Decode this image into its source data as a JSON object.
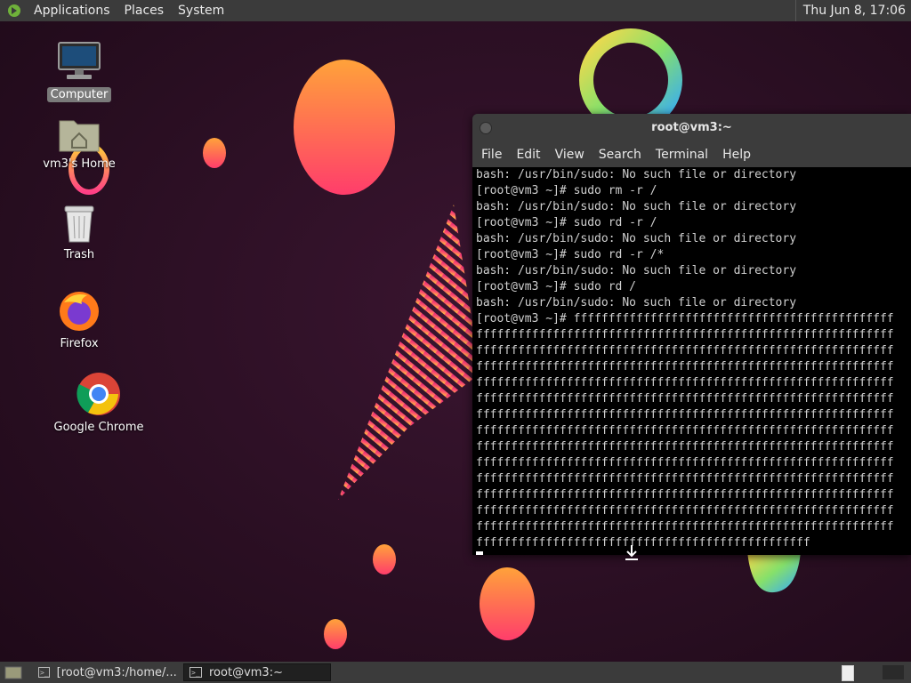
{
  "top_panel": {
    "menus": [
      "Applications",
      "Places",
      "System"
    ],
    "clock": "Thu Jun  8, 17:06"
  },
  "desktop": {
    "icons": [
      {
        "label": "Computer",
        "icon": "computer-icon"
      },
      {
        "label": "vm3's Home",
        "icon": "home-folder-icon"
      },
      {
        "label": "Trash",
        "icon": "trash-icon"
      },
      {
        "label": "Firefox",
        "icon": "firefox-icon"
      },
      {
        "label": "Google Chrome",
        "icon": "chrome-icon"
      }
    ]
  },
  "terminal": {
    "title": "root@vm3:~",
    "menu": [
      "File",
      "Edit",
      "View",
      "Search",
      "Terminal",
      "Help"
    ],
    "lines": [
      "bash: /usr/bin/sudo: No such file or directory",
      "[root@vm3 ~]# sudo rm -r /",
      "bash: /usr/bin/sudo: No such file or directory",
      "[root@vm3 ~]# sudo rd -r /",
      "bash: /usr/bin/sudo: No such file or directory",
      "[root@vm3 ~]# sudo rd -r /*",
      "bash: /usr/bin/sudo: No such file or directory",
      "[root@vm3 ~]# sudo rd /",
      "bash: /usr/bin/sudo: No such file or directory",
      "[root@vm3 ~]# ffffffffffffffffffffffffffffffffffffffffffffff",
      "ffffffffffffffffffffffffffffffffffffffffffffffffffffffffffff",
      "ffffffffffffffffffffffffffffffffffffffffffffffffffffffffffff",
      "ffffffffffffffffffffffffffffffffffffffffffffffffffffffffffff",
      "ffffffffffffffffffffffffffffffffffffffffffffffffffffffffffff",
      "ffffffffffffffffffffffffffffffffffffffffffffffffffffffffffff",
      "ffffffffffffffffffffffffffffffffffffffffffffffffffffffffffff",
      "ffffffffffffffffffffffffffffffffffffffffffffffffffffffffffff",
      "ffffffffffffffffffffffffffffffffffffffffffffffffffffffffffff",
      "ffffffffffffffffffffffffffffffffffffffffffffffffffffffffffff",
      "ffffffffffffffffffffffffffffffffffffffffffffffffffffffffffff",
      "ffffffffffffffffffffffffffffffffffffffffffffffffffffffffffff",
      "ffffffffffffffffffffffffffffffffffffffffffffffffffffffffffff",
      "ffffffffffffffffffffffffffffffffffffffffffffffffffffffffffff",
      "ffffffffffffffffffffffffffffffffffffffffffffffff"
    ]
  },
  "bottom_panel": {
    "tasks": [
      {
        "label": "[root@vm3:/home/...",
        "active": false
      },
      {
        "label": "root@vm3:~",
        "active": true
      }
    ]
  },
  "colors": {
    "panel": "#3b3b3b",
    "desktop_bg": "#2a0f22",
    "terminal_bg": "#000000",
    "terminal_fg": "#d0d0d0"
  }
}
